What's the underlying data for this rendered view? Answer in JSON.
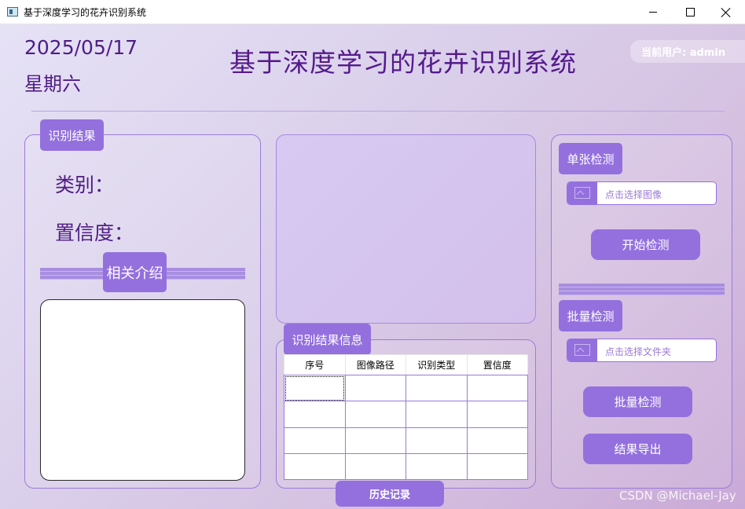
{
  "window": {
    "title": "基于深度学习的花卉识别系统",
    "minimize_icon": "minimize-icon",
    "maximize_icon": "maximize-icon",
    "close_icon": "close-icon"
  },
  "header": {
    "date": "2025/05/17",
    "weekday": "星期六",
    "title": "基于深度学习的花卉识别系统",
    "user_label": "当前用户: admin"
  },
  "result": {
    "group_label": "识别结果",
    "class_label": "类别：",
    "confidence_label": "置信度：",
    "intro_label": "相关介绍"
  },
  "table": {
    "group_label": "识别结果信息",
    "columns": [
      "序号",
      "图像路径",
      "识别类型",
      "置信度"
    ],
    "rows": [
      [
        "",
        "",
        "",
        ""
      ],
      [
        "",
        "",
        "",
        ""
      ],
      [
        "",
        "",
        "",
        ""
      ],
      [
        "",
        "",
        "",
        ""
      ]
    ]
  },
  "single": {
    "group_label": "单张检测",
    "picker_placeholder": "点击选择图像",
    "picker_icon": "image-icon",
    "start_button": "开始检测"
  },
  "batch": {
    "group_label": "批量检测",
    "picker_placeholder": "点击选择文件夹",
    "picker_icon": "folder-icon",
    "batch_button": "批量检测",
    "export_button": "结果导出"
  },
  "footer": {
    "history_button": "历史记录",
    "watermark": "CSDN @Michael-Jay"
  },
  "colors": {
    "accent": "#9470de",
    "title_text": "#551a8b"
  }
}
